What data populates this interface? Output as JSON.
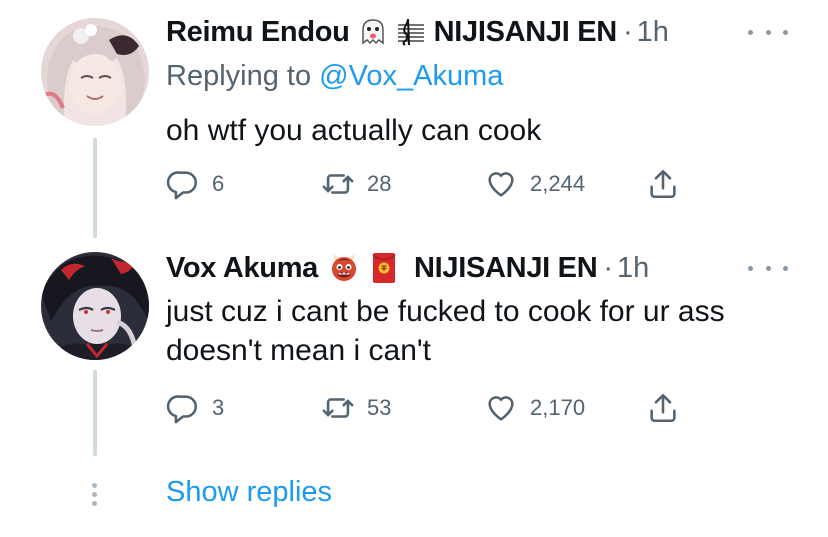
{
  "tweets": [
    {
      "author_name": "Reimu Endou",
      "name_emoji_1": "ghost-tongue-emoji",
      "name_emoji_2": "music-staff-emoji",
      "affiliation": "NIJISANJI EN",
      "separator": "·",
      "time": "1h",
      "replying_prefix": "Replying to ",
      "replying_handle": "@Vox_Akuma",
      "text_lines": [
        "oh wtf you actually can cook"
      ],
      "replies": "6",
      "retweets": "28",
      "likes": "2,244"
    },
    {
      "author_name": "Vox Akuma",
      "name_emoji_1": "ogre-emoji",
      "name_emoji_2": "red-envelope-emoji",
      "affiliation": "NIJISANJI EN",
      "separator": "·",
      "time": "1h",
      "text_lines": [
        "just cuz i cant be fucked to cook for ur ass",
        "doesn't mean i can't"
      ],
      "replies": "3",
      "retweets": "53",
      "likes": "2,170"
    }
  ],
  "show_replies": "Show replies",
  "colors": {
    "accent": "#1d9bf0",
    "secondary_text": "#536471",
    "thread_line": "#cfd9de"
  }
}
